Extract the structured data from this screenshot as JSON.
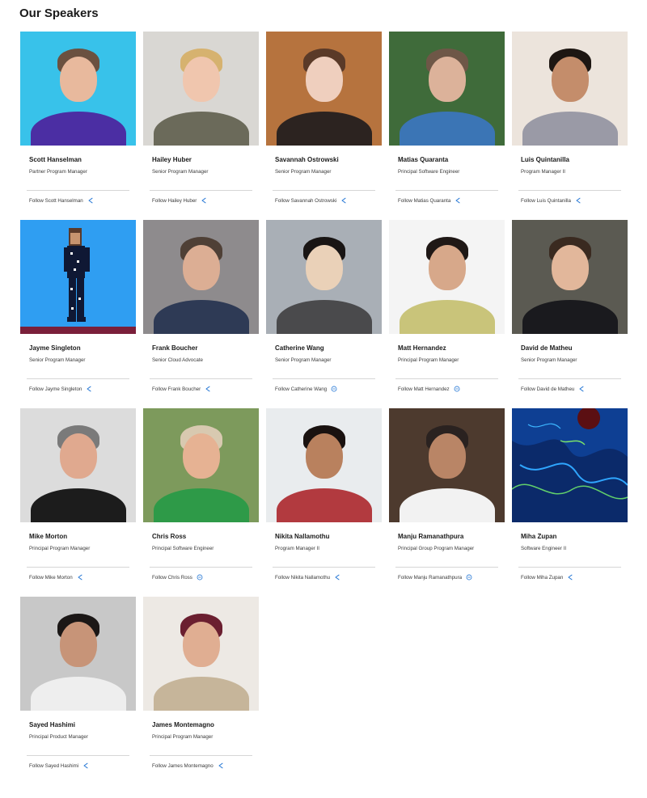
{
  "page": {
    "title": "Our Speakers"
  },
  "speakers": [
    {
      "name": "Scott Hanselman",
      "role": "Partner Program Manager",
      "follow": "Follow Scott Hanselman",
      "icon": "share-icon",
      "photo": {
        "bg": "#38c2ea",
        "skin": "#e8b99d",
        "hair": "#6b5140",
        "shirt": "#4b2ea3"
      }
    },
    {
      "name": "Hailey Huber",
      "role": "Senior Program Manager",
      "follow": "Follow Hailey Huber",
      "icon": "share-icon",
      "photo": {
        "bg": "#d9d7d3",
        "skin": "#f0c6ae",
        "hair": "#d6b26f",
        "shirt": "#6b6a5a"
      }
    },
    {
      "name": "Savannah Ostrowski",
      "role": "Senior Program Manager",
      "follow": "Follow Savannah Ostrowski",
      "icon": "share-icon",
      "photo": {
        "bg": "#b6733e",
        "skin": "#efcfbe",
        "hair": "#5a3a28",
        "shirt": "#2c2320"
      }
    },
    {
      "name": "Matias Quaranta",
      "role": "Principal Software Engineer",
      "follow": "Follow Matias Quaranta",
      "icon": "share-icon",
      "photo": {
        "bg": "#3f6b3a",
        "skin": "#dcb29a",
        "hair": "#6e5747",
        "shirt": "#3b75b5"
      }
    },
    {
      "name": "Luis Quintanilla",
      "role": "Program Manager II",
      "follow": "Follow Luis Quintanilla",
      "icon": "share-icon",
      "photo": {
        "bg": "#ece4dc",
        "skin": "#c48d6b",
        "hair": "#1d1612",
        "shirt": "#9a9aa6"
      }
    },
    {
      "name": "Jayme Singleton",
      "role": "Senior Program Manager",
      "follow": "Follow Jayme Singleton",
      "icon": "share-icon",
      "photo": {
        "bg": "#2f9ef2",
        "pixel": true
      }
    },
    {
      "name": "Frank Boucher",
      "role": "Senior Cloud Advocate",
      "follow": "Follow Frank Boucher",
      "icon": "share-icon",
      "photo": {
        "bg": "#8e8b8d",
        "skin": "#dcae94",
        "hair": "#4f4036",
        "shirt": "#2e3a55"
      }
    },
    {
      "name": "Catherine Wang",
      "role": "Senior Program Manager",
      "follow": "Follow Catherine Wang",
      "icon": "circle-minus-icon",
      "photo": {
        "bg": "#a9afb6",
        "skin": "#ead1b8",
        "hair": "#191514",
        "shirt": "#4a4a4c"
      }
    },
    {
      "name": "Matt Hernandez",
      "role": "Principal Program Manager",
      "follow": "Follow Matt Hernandez",
      "icon": "circle-minus-icon",
      "photo": {
        "bg": "#f4f4f4",
        "skin": "#d7a88a",
        "hair": "#1f1816",
        "shirt": "#c9c47a"
      }
    },
    {
      "name": "David de Matheu",
      "role": "Senior Program Manager",
      "follow": "Follow David de Matheu",
      "icon": "share-icon",
      "photo": {
        "bg": "#5b5a52",
        "skin": "#e2b79b",
        "hair": "#3a2a20",
        "shirt": "#1a1a1e"
      }
    },
    {
      "name": "Mike Morton",
      "role": "Principal Program Manager",
      "follow": "Follow Mike Morton",
      "icon": "share-icon",
      "photo": {
        "bg": "#dcdcdc",
        "skin": "#e0a98f",
        "hair": "#7a7a7a",
        "shirt": "#1c1c1c"
      }
    },
    {
      "name": "Chris Ross",
      "role": "Principal Software Engineer",
      "follow": "Follow Chris Ross",
      "icon": "circle-minus-icon",
      "photo": {
        "bg": "#7d9a5c",
        "skin": "#e6b293",
        "hair": "#d8c9b0",
        "shirt": "#2e9a48"
      }
    },
    {
      "name": "Nikita Nallamothu",
      "role": "Program Manager II",
      "follow": "Follow Nikita Nallamothu",
      "icon": "share-icon",
      "photo": {
        "bg": "#e9ecee",
        "skin": "#b9815e",
        "hair": "#1a1210",
        "shirt": "#b23a3f"
      }
    },
    {
      "name": "Manju Ramanathpura",
      "role": "Principal Group Program Manager",
      "follow": "Follow Manju Ramanathpura",
      "icon": "circle-minus-icon",
      "photo": {
        "bg": "#4d3a2e",
        "skin": "#b98566",
        "hair": "#2a2220",
        "shirt": "#f2f2f2"
      }
    },
    {
      "name": "Miha Zupan",
      "role": "Software Engineer II",
      "follow": "Follow Miha Zupan",
      "icon": "share-icon",
      "photo": {
        "bg": "#0b2a6a",
        "fractal": true
      }
    },
    {
      "name": "Sayed Hashimi",
      "role": "Principal Product Manager",
      "follow": "Follow Sayed Hashimi",
      "icon": "share-icon",
      "photo": {
        "bg": "#c8c8c8",
        "skin": "#c79478",
        "hair": "#1b1716",
        "shirt": "#eeeeee"
      }
    },
    {
      "name": "James Montemagno",
      "role": "Principal Program Manager",
      "follow": "Follow James Montemagno",
      "icon": "share-icon",
      "photo": {
        "bg": "#ede9e4",
        "skin": "#e0ae92",
        "hair": "#6b1f30",
        "shirt": "#c6b59a"
      }
    }
  ],
  "colors": {
    "link_accent": "#2a7ad6",
    "divider": "#d6d6d6"
  }
}
